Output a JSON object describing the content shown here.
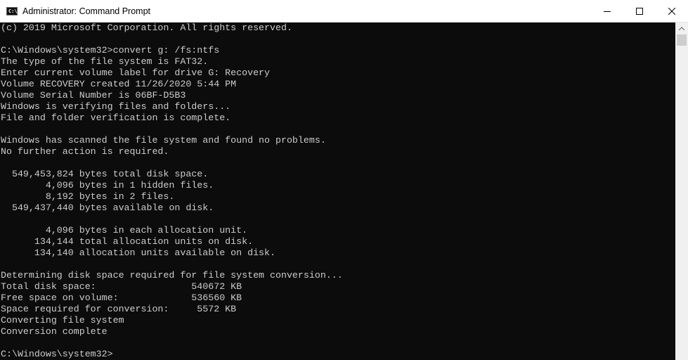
{
  "window": {
    "title": "Administrator: Command Prompt",
    "icon_name": "command-prompt-icon",
    "icon_text": "C:\\."
  },
  "controls": {
    "minimize_icon": "minimize-icon",
    "maximize_icon": "maximize-icon",
    "close_icon": "close-icon"
  },
  "console": {
    "background": "#0c0c0c",
    "foreground": "#cccccc",
    "lines": [
      "(c) 2019 Microsoft Corporation. All rights reserved.",
      "",
      "C:\\Windows\\system32>convert g: /fs:ntfs",
      "The type of the file system is FAT32.",
      "Enter current volume label for drive G: Recovery",
      "Volume RECOVERY created 11/26/2020 5:44 PM",
      "Volume Serial Number is 06BF-D5B3",
      "Windows is verifying files and folders...",
      "File and folder verification is complete.",
      "",
      "Windows has scanned the file system and found no problems.",
      "No further action is required.",
      "",
      "  549,453,824 bytes total disk space.",
      "        4,096 bytes in 1 hidden files.",
      "        8,192 bytes in 2 files.",
      "  549,437,440 bytes available on disk.",
      "",
      "        4,096 bytes in each allocation unit.",
      "      134,144 total allocation units on disk.",
      "      134,140 allocation units available on disk.",
      "",
      "Determining disk space required for file system conversion...",
      "Total disk space:                 540672 KB",
      "Free space on volume:             536560 KB",
      "Space required for conversion:     5572 KB",
      "Converting file system",
      "Conversion complete",
      "",
      "C:\\Windows\\system32>"
    ]
  }
}
